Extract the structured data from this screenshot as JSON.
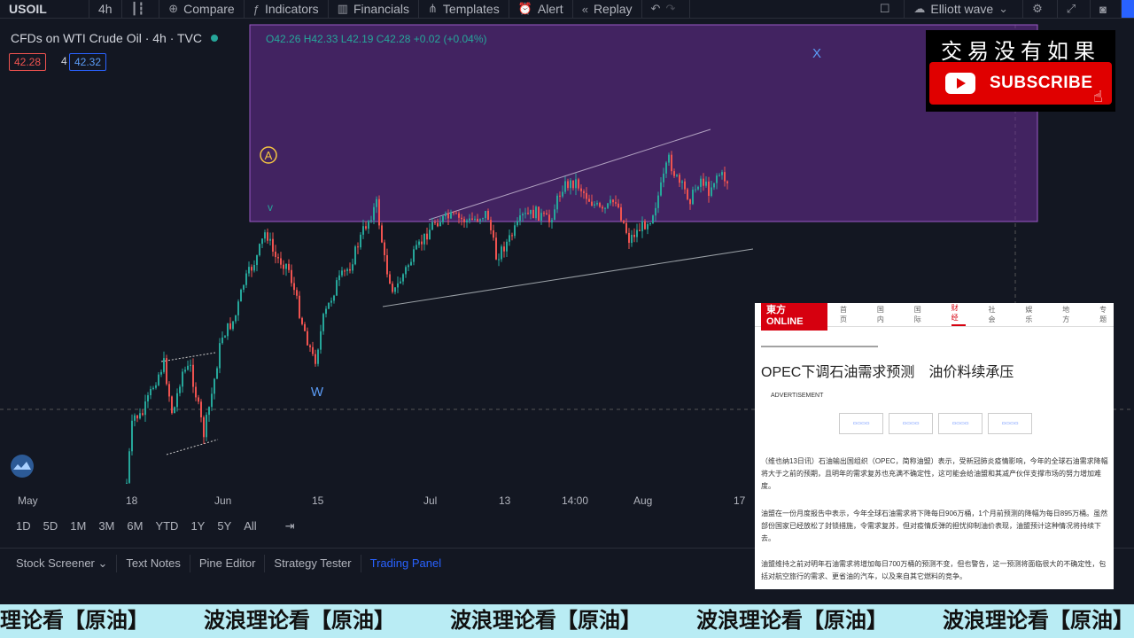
{
  "toolbar": {
    "symbol": "USOIL",
    "interval": "4h",
    "compare": "Compare",
    "indicators": "Indicators",
    "financials": "Financials",
    "templates": "Templates",
    "alert": "Alert",
    "replay": "Replay",
    "layout_name": "Elliott wave"
  },
  "legend": {
    "title": "CFDs on WTI Crude Oil · 4h · TVC",
    "ohlc": "O42.26  H42.33  L42.19  C42.28  +0.02 (+0.04%)",
    "sell_price": "42.28",
    "qty": "4",
    "buy_price": "42.32"
  },
  "waves": {
    "a": "A",
    "v": "v",
    "w": "W",
    "x": "X"
  },
  "xaxis": [
    "May",
    "18",
    "Jun",
    "15",
    "Jul",
    "13",
    "14:00",
    "Aug",
    "17"
  ],
  "ranges": [
    "1D",
    "5D",
    "1M",
    "3M",
    "6M",
    "YTD",
    "1Y",
    "5Y",
    "All"
  ],
  "bottom_tabs": [
    "Stock Screener",
    "Text Notes",
    "Pine Editor",
    "Strategy Tester",
    "Trading Panel"
  ],
  "subscribe": {
    "title": "交易没有如果",
    "button": "SUBSCRIBE"
  },
  "news": {
    "logo": "東方ONLINE",
    "nav": [
      "首页",
      "国内",
      "国际",
      "财经",
      "社会",
      "娱乐",
      "地方",
      "专题"
    ],
    "headline": "OPEC下调石油需求预测　油价料续承压",
    "advertisement": "ADVERTISEMENT",
    "p1": "（维也纳13日讯）石油输出国组织（OPEC，简称油盟）表示，受新冠肺炎疫情影响，今年的全球石油需求降幅将大于之前的预期，且明年的需求复苏也充满不确定性，这可能会给油盟和其减产伙伴支撑市场的努力增加难度。",
    "p2": "油盟在一份月度报告中表示，今年全球石油需求将下降每日906万桶，1个月前预测的降幅为每日895万桶。虽然部份国家已经放松了封锁措施，令需求复苏，但对疫情反弹的担忧抑制油价表现，油盟预计这种情况将持续下去。",
    "p3": "油盟维持之前对明年石油需求将增加每日700万桶的预测不变，但也警告，这一预测将面临很大的不确定性，包括对航空旅行的需求、更省油的汽车，以及来自其它燃料的竞争。"
  },
  "ticker": "波浪理论看【原油】",
  "colors": {
    "up": "#26a69a",
    "down": "#ef5350",
    "zone": "#7b3fa8"
  }
}
